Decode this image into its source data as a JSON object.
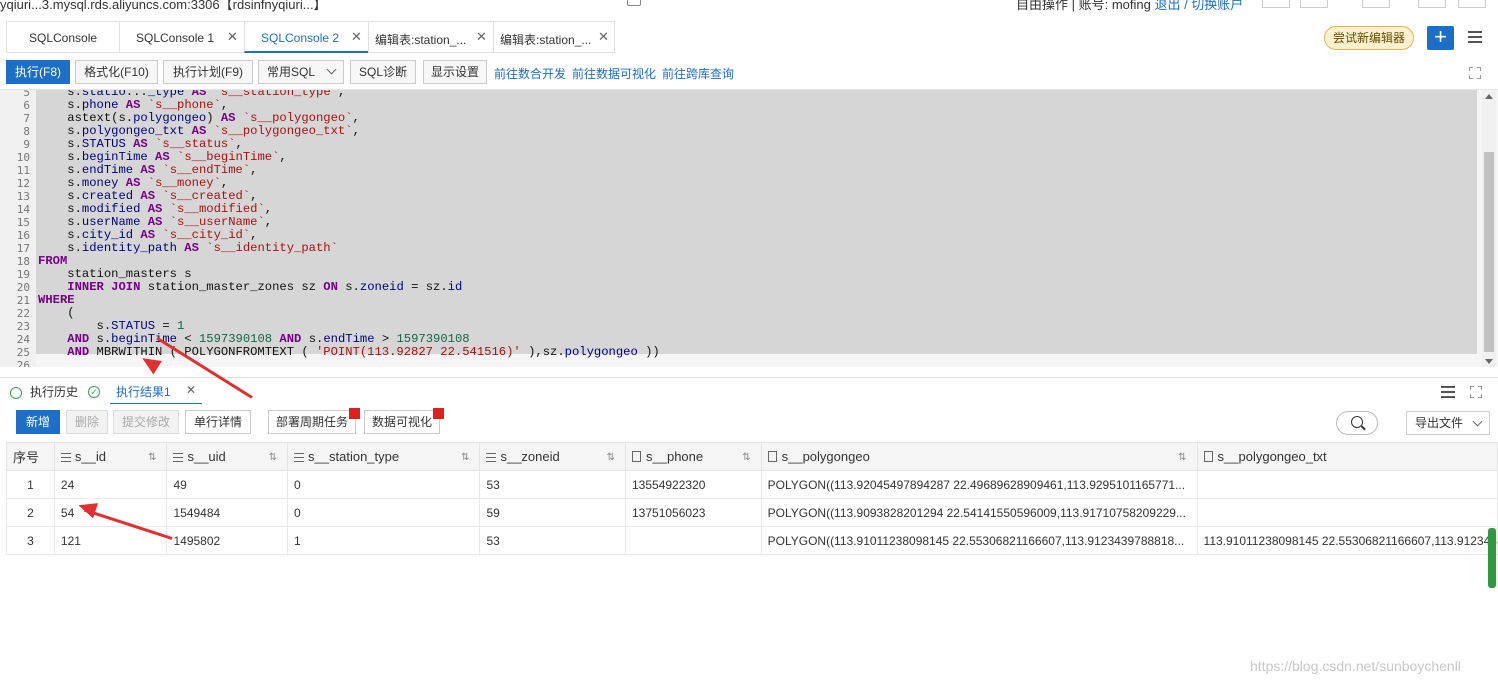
{
  "topbar": {
    "connection": "yqiuri...3.mysql.rds.aliyuncs.com:3306【rdsinfnyqiuri...】",
    "user_text": "自由操作 | 账号: mofing",
    "logout_link": "退出 / 切换账户"
  },
  "tabs": [
    {
      "label": "SQLConsole",
      "closable": false,
      "active": false
    },
    {
      "label": "SQLConsole 1",
      "closable": true,
      "active": false
    },
    {
      "label": "SQLConsole 2",
      "closable": true,
      "active": true
    },
    {
      "label": "编辑表:station_...",
      "closable": true,
      "active": false
    },
    {
      "label": "编辑表:station_...",
      "closable": true,
      "active": false
    }
  ],
  "try_new_editor": "尝试新编辑器",
  "toolbar": {
    "execute": "执行(F8)",
    "format": "格式化(F10)",
    "plan": "执行计划(F9)",
    "common_sql": "常用SQL",
    "diagnose": "SQL诊断",
    "display_settings": "显示设置",
    "link_data_dev": "前往数合开发",
    "link_data_vis": "前往数据可视化",
    "link_cross_db": "前往跨库查询"
  },
  "editor": {
    "lines": [
      {
        "n": "5",
        "text": "    s.statio..._type AS `s__station_type`,"
      },
      {
        "n": "6",
        "text": "    s.phone AS `s__phone`,"
      },
      {
        "n": "7",
        "text": "    astext(s.polygongeo) AS `s__polygongeo`,"
      },
      {
        "n": "8",
        "text": "    s.polygongeo_txt AS `s__polygongeo_txt`,"
      },
      {
        "n": "9",
        "text": "    s.STATUS AS `s__status`,"
      },
      {
        "n": "10",
        "text": "    s.beginTime AS `s__beginTime`,"
      },
      {
        "n": "11",
        "text": "    s.endTime AS `s__endTime`,"
      },
      {
        "n": "12",
        "text": "    s.money AS `s__money`,"
      },
      {
        "n": "13",
        "text": "    s.created AS `s__created`,"
      },
      {
        "n": "14",
        "text": "    s.modified AS `s__modified`,"
      },
      {
        "n": "15",
        "text": "    s.userName AS `s__userName`,"
      },
      {
        "n": "16",
        "text": "    s.city_id AS `s__city_id`,"
      },
      {
        "n": "17",
        "text": "    s.identity_path AS `s__identity_path`"
      },
      {
        "n": "18",
        "text": "FROM"
      },
      {
        "n": "19",
        "text": "    station_masters s"
      },
      {
        "n": "20",
        "text": "    INNER JOIN station_master_zones sz ON s.zoneid = sz.id"
      },
      {
        "n": "21",
        "text": "WHERE"
      },
      {
        "n": "22",
        "text": "    ("
      },
      {
        "n": "23",
        "text": "        s.STATUS = 1"
      },
      {
        "n": "24",
        "text": "    AND s.beginTime < 1597390108 AND s.endTime > 1597390108"
      },
      {
        "n": "25",
        "text": "    AND MBRWITHIN ( POLYGONFROMTEXT ( 'POINT(113.92827 22.541516)' ),sz.polygongeo ))"
      },
      {
        "n": "26",
        "text": ""
      }
    ]
  },
  "result_tabs": {
    "history": "执行历史",
    "result": "执行结果1"
  },
  "grid_toolbar": {
    "add": "新增",
    "delete": "删除",
    "submit": "提交修改",
    "row_detail": "单行详情",
    "deploy_task": "部署周期任务",
    "data_vis": "数据可视化",
    "export": "导出文件"
  },
  "table": {
    "columns": [
      "序号",
      "s__id",
      "s__uid",
      "s__station_type",
      "s__zoneid",
      "s__phone",
      "s__polygongeo",
      "s__polygongeo_txt"
    ],
    "rows": [
      [
        "1",
        "24",
        "49",
        "0",
        "53",
        "13554922320",
        "POLYGON((113.92045497894287 22.49689628909461,113.9295101165771...",
        ""
      ],
      [
        "2",
        "54",
        "1549484",
        "0",
        "59",
        "13751056023",
        "POLYGON((113.9093828201294 22.54141550596009,113.91710758209229...",
        ""
      ],
      [
        "3",
        "121",
        "1495802",
        "1",
        "53",
        "",
        "POLYGON((113.91011238098145 22.55306821166607,113.9123439788818...",
        "113.91011238098145 22.55306821166607,113.912343"
      ]
    ]
  },
  "watermark": "https://blog.csdn.net/sunboychenll",
  "colors": {
    "accent": "#1c6ec7",
    "annotation_arrow": "#e23030"
  }
}
